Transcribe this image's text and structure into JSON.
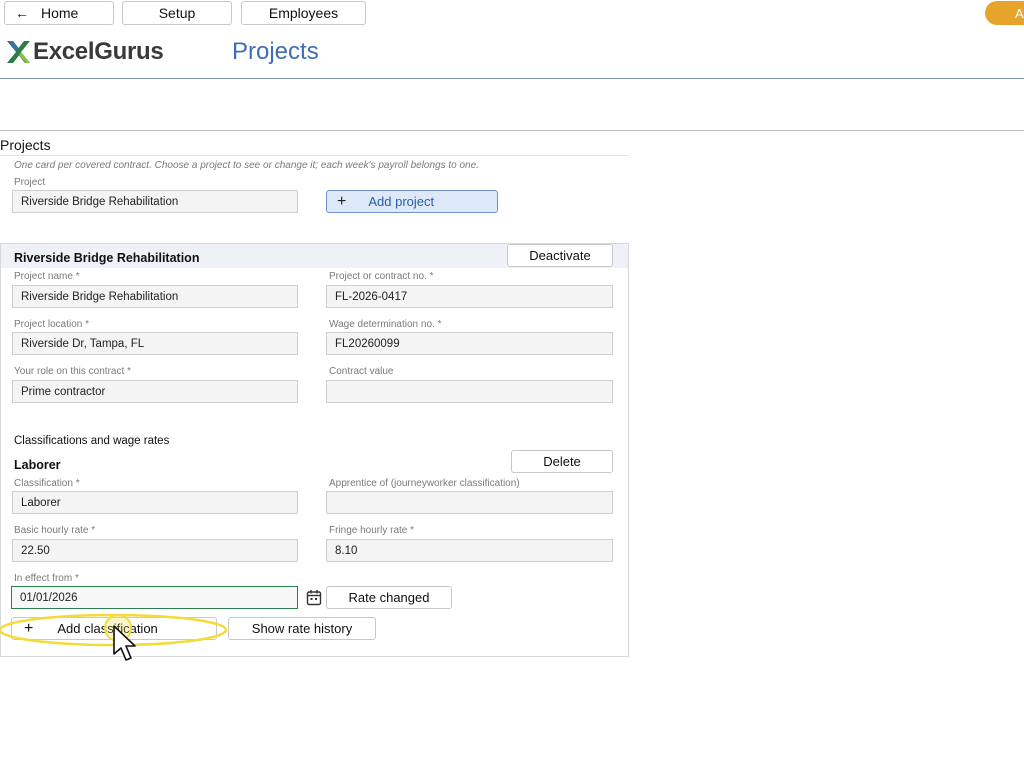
{
  "nav": {
    "home": "Home",
    "setup": "Setup",
    "employees": "Employees",
    "account_initial": "A"
  },
  "brand": {
    "name": "ExcelGurus"
  },
  "page_title": "Projects",
  "section": {
    "title": "Projects",
    "hint": "One card per covered contract. Choose a project to see or change it; each week's payroll belongs to one.",
    "project_label": "Project",
    "project_value": "Riverside Bridge Rehabilitation",
    "add_project": "Add project"
  },
  "card": {
    "title": "Riverside Bridge Rehabilitation",
    "deactivate": "Deactivate",
    "fields": {
      "project_name_label": "Project name *",
      "project_name_value": "Riverside Bridge Rehabilitation",
      "contract_no_label": "Project or contract no. *",
      "contract_no_value": "FL-2026-0417",
      "location_label": "Project location *",
      "location_value": "Riverside Dr, Tampa, FL",
      "wage_det_label": "Wage determination no. *",
      "wage_det_value": "FL20260099",
      "role_label": "Your role on this contract *",
      "role_value": "Prime contractor",
      "contract_value_label": "Contract value",
      "contract_value_value": ""
    },
    "classifications": {
      "heading": "Classifications and wage rates",
      "item_title": "Laborer",
      "delete": "Delete",
      "classification_label": "Classification *",
      "classification_value": "Laborer",
      "apprentice_label": "Apprentice of (journeyworker classification)",
      "apprentice_value": "",
      "basic_rate_label": "Basic hourly rate *",
      "basic_rate_value": "22.50",
      "fringe_rate_label": "Fringe hourly rate *",
      "fringe_rate_value": "8.10",
      "effect_label": "In effect from *",
      "effect_value": "01/01/2026",
      "rate_changed": "Rate changed",
      "add_classification": "Add classification",
      "show_rate_history": "Show rate history"
    }
  },
  "colors": {
    "brand_blue": "#3d6fb8",
    "accent_orange": "#e7a42c",
    "highlight_yellow": "#f2dc3a",
    "active_border_green": "#2e7d4f"
  }
}
